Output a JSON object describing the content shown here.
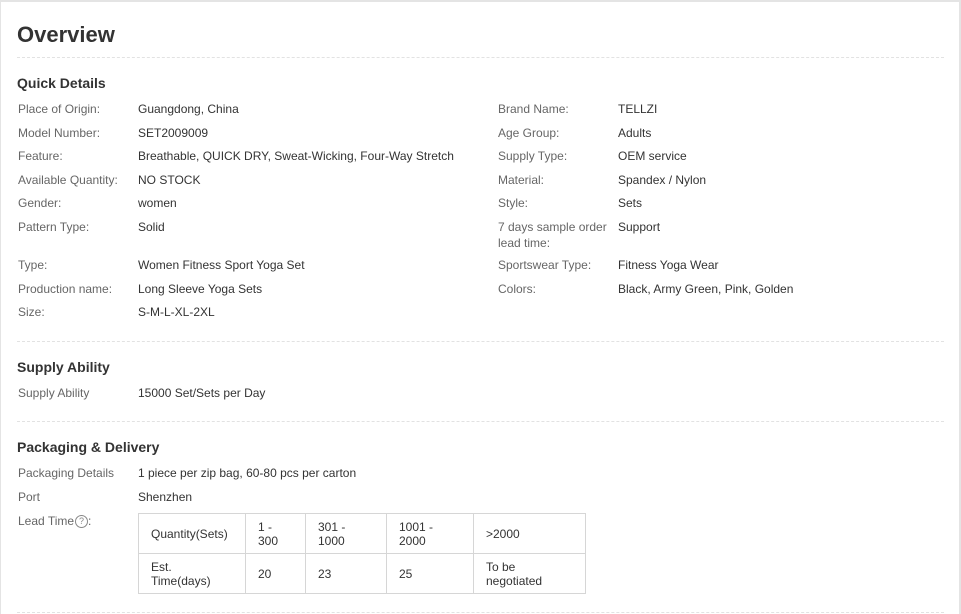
{
  "page_title": "Overview",
  "quick_details": {
    "title": "Quick Details",
    "left": [
      {
        "label": "Place of Origin:",
        "value": "Guangdong, China"
      },
      {
        "label": "Model Number:",
        "value": "SET2009009"
      },
      {
        "label": "Feature:",
        "value": "Breathable, QUICK DRY, Sweat-Wicking, Four-Way Stretch"
      },
      {
        "label": "Available Quantity:",
        "value": "NO STOCK"
      },
      {
        "label": "Gender:",
        "value": "women"
      },
      {
        "label": "Pattern Type:",
        "value": "Solid"
      },
      {
        "label": "Type:",
        "value": "Women Fitness Sport Yoga Set"
      },
      {
        "label": "Production name:",
        "value": "Long Sleeve Yoga Sets"
      },
      {
        "label": "Size:",
        "value": "S-M-L-XL-2XL"
      }
    ],
    "right": [
      {
        "label": "Brand Name:",
        "value": "TELLZI"
      },
      {
        "label": "Age Group:",
        "value": "Adults"
      },
      {
        "label": "Supply Type:",
        "value": "OEM service"
      },
      {
        "label": "Material:",
        "value": "Spandex / Nylon"
      },
      {
        "label": "Style:",
        "value": "Sets"
      },
      {
        "label": "7 days sample order lead time:",
        "value": "Support"
      },
      {
        "label": "Sportswear Type:",
        "value": "Fitness Yoga Wear"
      },
      {
        "label": "Colors:",
        "value": "Black, Army Green, Pink, Golden"
      }
    ]
  },
  "supply_ability": {
    "title": "Supply Ability",
    "label": "Supply Ability",
    "value": "15000 Set/Sets per Day"
  },
  "packaging": {
    "title": "Packaging & Delivery",
    "details_label": "Packaging Details",
    "details_value": "1 piece per zip bag, 60-80 pcs per carton",
    "port_label": "Port",
    "port_value": "Shenzhen",
    "lead_time_label": "Lead Time",
    "lead_time_colon": ":",
    "help_glyph": "?",
    "help_icon": "question-circle-icon",
    "lead_table": {
      "row1": [
        "Quantity(Sets)",
        "1 - 300",
        "301 - 1000",
        "1001 - 2000",
        ">2000"
      ],
      "row2": [
        "Est. Time(days)",
        "20",
        "23",
        "25",
        "To be negotiated"
      ]
    }
  }
}
